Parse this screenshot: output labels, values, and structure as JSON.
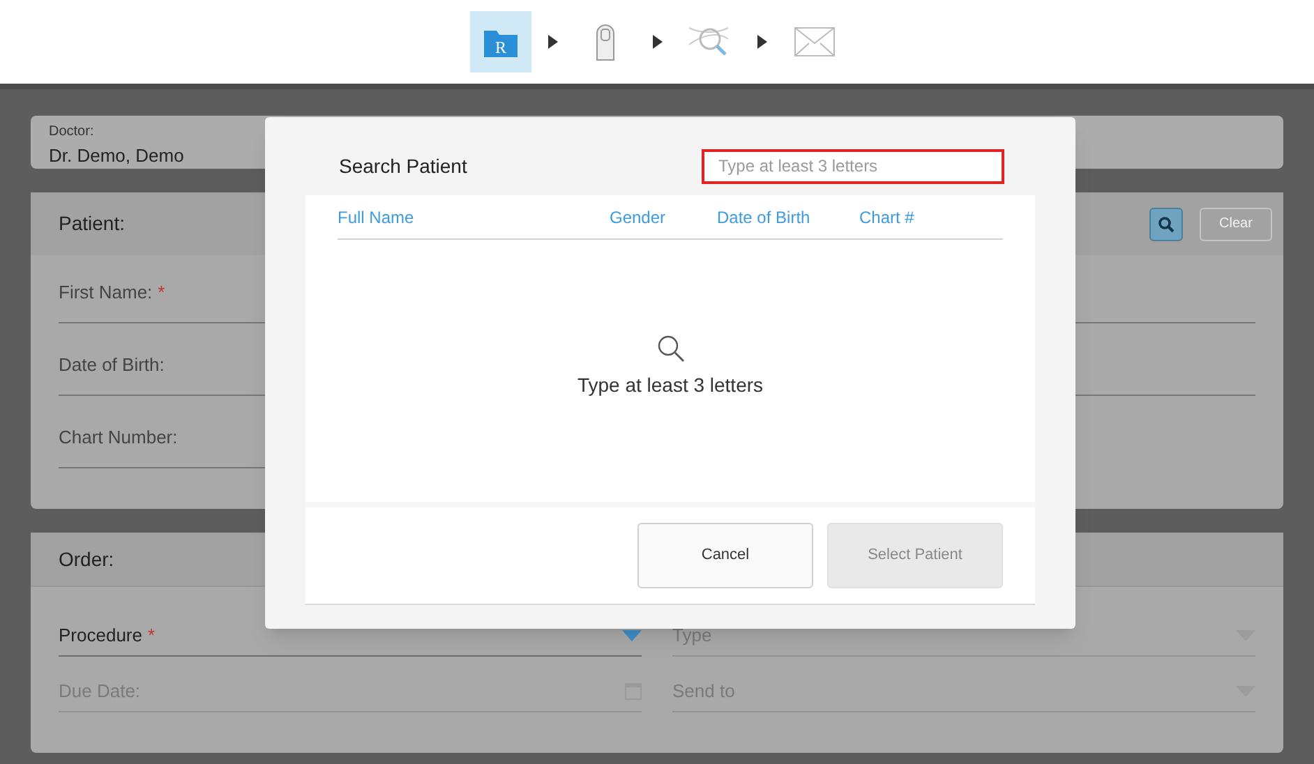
{
  "workflow_steps": [
    {
      "kind": "rx",
      "letter": "R",
      "selected": true
    },
    {
      "kind": "scan",
      "selected": false
    },
    {
      "kind": "view",
      "selected": false
    },
    {
      "kind": "send",
      "selected": false
    }
  ],
  "required_marker": "*",
  "doctor": {
    "label": "Doctor:",
    "value": "Dr. Demo, Demo"
  },
  "patient": {
    "title": "Patient:",
    "clear_button": "Clear",
    "clear_disabled": true,
    "fields": [
      {
        "label": "First Name:",
        "required": true
      },
      {
        "label": "Date of Birth:",
        "required": false
      },
      {
        "label": "Chart Number:",
        "required": false
      }
    ]
  },
  "order": {
    "title": "Order:",
    "fields": [
      {
        "label": "Procedure",
        "required": true,
        "kind": "dropdown",
        "disabled": false
      },
      {
        "label": "Type",
        "required": false,
        "kind": "dropdown",
        "disabled": true
      },
      {
        "label": "Due Date:",
        "required": false,
        "kind": "date",
        "disabled": true
      },
      {
        "label": "Send to",
        "required": false,
        "kind": "dropdown",
        "disabled": true
      }
    ]
  },
  "dialog": {
    "title": "Search Patient",
    "search": {
      "placeholder": "Type at least 3 letters"
    },
    "columns": [
      "Full Name",
      "Gender",
      "Date of Birth",
      "Chart #"
    ],
    "empty_message": "Type at least 3 letters",
    "buttons": [
      {
        "label": "Cancel",
        "disabled": false
      },
      {
        "label": "Select Patient",
        "disabled": true
      }
    ]
  }
}
